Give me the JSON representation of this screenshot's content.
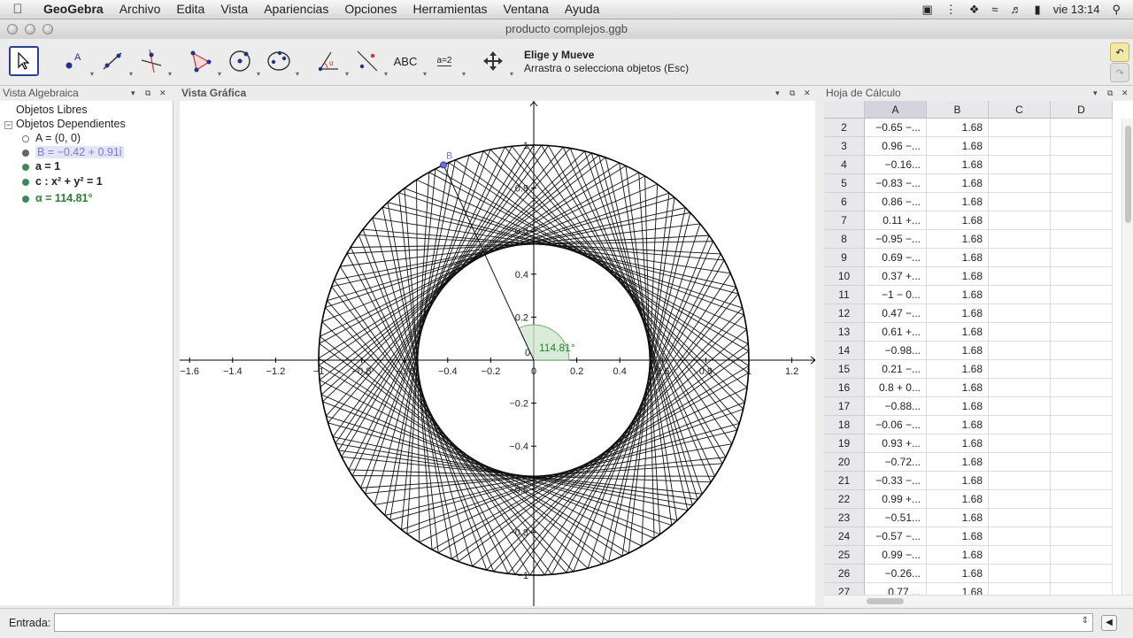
{
  "menubar": {
    "app": "GeoGebra",
    "items": [
      "Archivo",
      "Edita",
      "Vista",
      "Apariencias",
      "Opciones",
      "Herramientas",
      "Ventana",
      "Ayuda"
    ],
    "clock": "vie 13:14"
  },
  "window": {
    "title": "producto complejos.ggb"
  },
  "toolbar": {
    "help_title": "Elige y Mueve",
    "help_text": "Arrastra o selecciona objetos (Esc)",
    "abc_label": "ABC",
    "slider_label": "a=2"
  },
  "algebra": {
    "title": "Vista Algebraica",
    "free_header": "Objetos Libres",
    "dependent_header": "Objetos Dependientes",
    "items": [
      {
        "text": "A = (0, 0)",
        "color": "#ffffff"
      },
      {
        "text": "B = −0.42 + 0.91ί",
        "color": "#7b7bd8"
      },
      {
        "text": "a = 1",
        "color": "#3a8a5a"
      },
      {
        "text": "c : x² + y² = 1",
        "color": "#3a8a5a"
      },
      {
        "text": "α = 114.81°",
        "color": "#2e7d32"
      }
    ]
  },
  "graphics": {
    "title": "Vista Gráfica",
    "point_label": "B",
    "angle_label": "114.81°",
    "x_ticks": [
      "−1.6",
      "−1.4",
      "−1.2",
      "−1",
      "−0.8",
      "−0.6",
      "−0.4",
      "−0.2",
      "0",
      "0.2",
      "0.4",
      "0.6",
      "0.8",
      "1",
      "1.2"
    ],
    "y_ticks": [
      "1",
      "0.8",
      "0.6",
      "0.4",
      "0.2",
      "0",
      "−0.2",
      "−0.4",
      "−0.6",
      "−0.8",
      "−1"
    ],
    "origin_label": "0"
  },
  "spreadsheet": {
    "title": "Hoja de Cálculo",
    "columns": [
      "A",
      "B",
      "C",
      "D"
    ],
    "rows": [
      {
        "n": "2",
        "a": "−0.65 −...",
        "b": "1.68"
      },
      {
        "n": "3",
        "a": "0.96 −...",
        "b": "1.68"
      },
      {
        "n": "4",
        "a": "−0.16...",
        "b": "1.68"
      },
      {
        "n": "5",
        "a": "−0.83 −...",
        "b": "1.68"
      },
      {
        "n": "6",
        "a": "0.86 −...",
        "b": "1.68"
      },
      {
        "n": "7",
        "a": "0.11 +...",
        "b": "1.68"
      },
      {
        "n": "8",
        "a": "−0.95 −...",
        "b": "1.68"
      },
      {
        "n": "9",
        "a": "0.69 −...",
        "b": "1.68"
      },
      {
        "n": "10",
        "a": "0.37 +...",
        "b": "1.68"
      },
      {
        "n": "11",
        "a": "−1 − 0...",
        "b": "1.68"
      },
      {
        "n": "12",
        "a": "0.47 −...",
        "b": "1.68"
      },
      {
        "n": "13",
        "a": "0.61 +...",
        "b": "1.68"
      },
      {
        "n": "14",
        "a": "−0.98...",
        "b": "1.68"
      },
      {
        "n": "15",
        "a": "0.21 −...",
        "b": "1.68"
      },
      {
        "n": "16",
        "a": "0.8 + 0...",
        "b": "1.68"
      },
      {
        "n": "17",
        "a": "−0.88...",
        "b": "1.68"
      },
      {
        "n": "18",
        "a": "−0.06 −...",
        "b": "1.68"
      },
      {
        "n": "19",
        "a": "0.93 +...",
        "b": "1.68"
      },
      {
        "n": "20",
        "a": "−0.72...",
        "b": "1.68"
      },
      {
        "n": "21",
        "a": "−0.33 −...",
        "b": "1.68"
      },
      {
        "n": "22",
        "a": "0.99 +...",
        "b": "1.68"
      },
      {
        "n": "23",
        "a": "−0.51...",
        "b": "1.68"
      },
      {
        "n": "24",
        "a": "−0.57 −...",
        "b": "1.68"
      },
      {
        "n": "25",
        "a": "0.99 −...",
        "b": "1.68"
      },
      {
        "n": "26",
        "a": "−0.26...",
        "b": "1.68"
      },
      {
        "n": "27",
        "a": "0.77 ...",
        "b": "1.68"
      }
    ]
  },
  "input": {
    "label": "Entrada:",
    "value": ""
  }
}
